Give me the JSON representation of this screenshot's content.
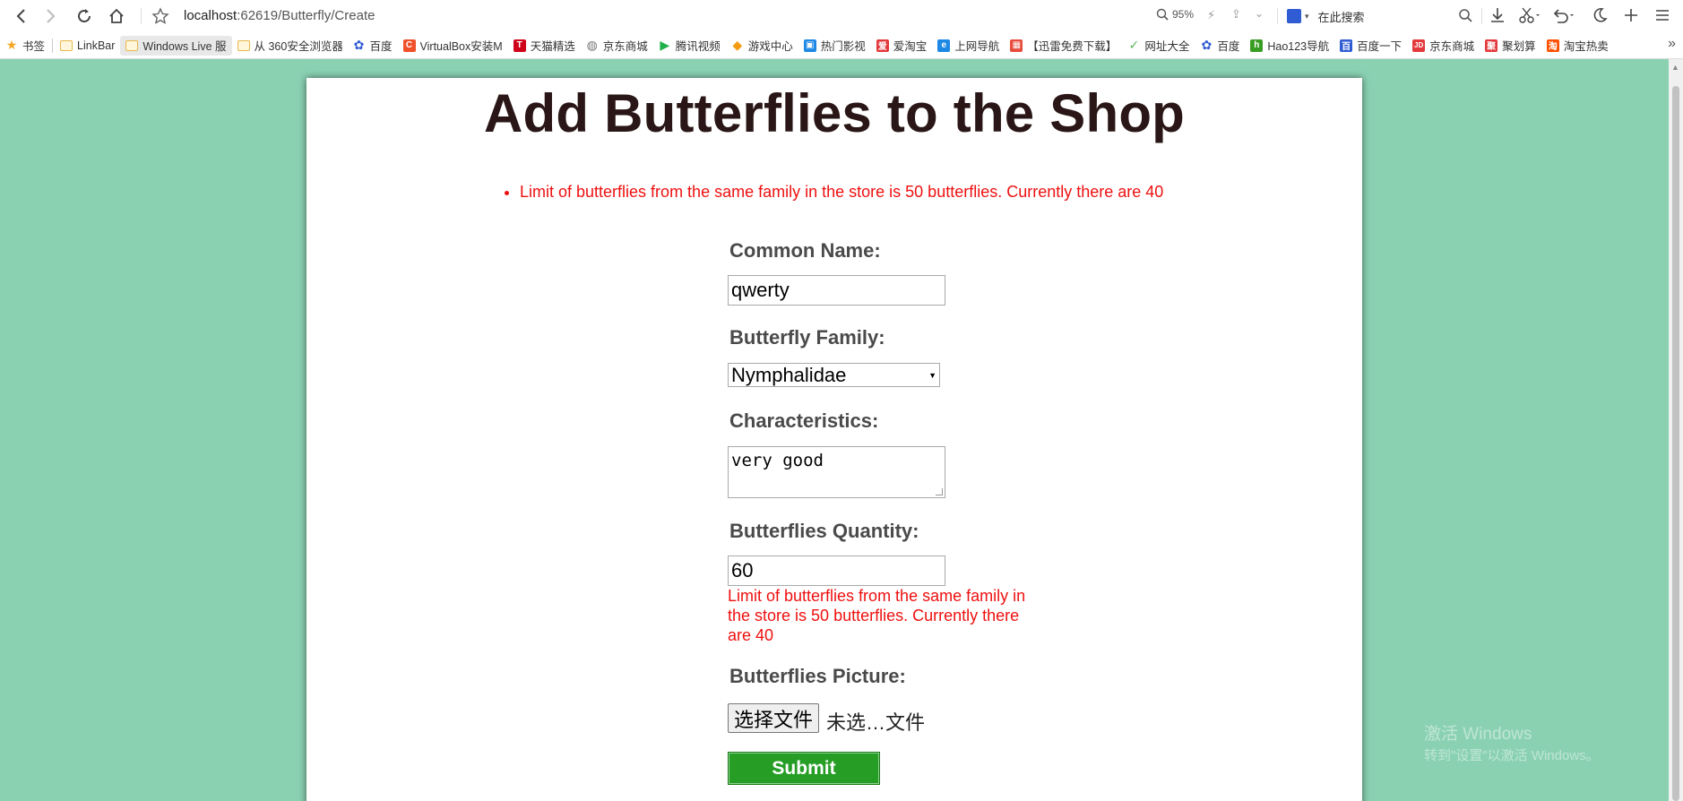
{
  "browser": {
    "url_host": "localhost",
    "url_path": ":62619/Butterfly/Create",
    "zoom": "95%",
    "search_placeholder": "在此搜索"
  },
  "bookmarks": [
    {
      "label": "书签",
      "icon": "star-icon",
      "color": "#f5a623"
    },
    {
      "label": "LinkBar",
      "icon": "folder-icon",
      "color": "#e8b84a"
    },
    {
      "label": "Windows Live 服",
      "icon": "folder-icon",
      "color": "#e8b84a"
    },
    {
      "label": "从 360安全浏览器",
      "icon": "folder-icon",
      "color": "#e8b84a"
    },
    {
      "label": "百度",
      "icon": "paw-icon",
      "color": "#2f5bd3"
    },
    {
      "label": "VirtualBox安装M",
      "icon": "c-icon",
      "color": "#f0502a"
    },
    {
      "label": "天猫精选",
      "icon": "t-icon",
      "color": "#d0021b"
    },
    {
      "label": "京东商城",
      "icon": "globe-icon",
      "color": "#777777"
    },
    {
      "label": "腾讯视频",
      "icon": "play-icon",
      "color": "#20b04b"
    },
    {
      "label": "游戏中心",
      "icon": "gamepad-icon",
      "color": "#f39c12"
    },
    {
      "label": "热门影视",
      "icon": "film-icon",
      "color": "#1e88e5"
    },
    {
      "label": "爱淘宝",
      "icon": "ai-icon",
      "color": "#e4393c"
    },
    {
      "label": "上网导航",
      "icon": "e-icon",
      "color": "#1e88e5"
    },
    {
      "label": "【迅雷免费下载】",
      "icon": "windows-icon",
      "color": "#e74c3c"
    },
    {
      "label": "网址大全",
      "icon": "leaf-icon",
      "color": "#5cb85c"
    },
    {
      "label": "百度",
      "icon": "paw-icon",
      "color": "#2f5bd3"
    },
    {
      "label": "Hao123导航",
      "icon": "hao-icon",
      "color": "#3a9d23"
    },
    {
      "label": "百度一下",
      "icon": "baidu-icon",
      "color": "#2f5bd3"
    },
    {
      "label": "京东商城",
      "icon": "jd-icon",
      "color": "#e4393c"
    },
    {
      "label": "聚划算",
      "icon": "ju-icon",
      "color": "#e4393c"
    },
    {
      "label": "淘宝热卖",
      "icon": "taobao-icon",
      "color": "#ff5000"
    }
  ],
  "page": {
    "title": "Add Butterflies to the Shop",
    "validation_summary": "Limit of butterflies from the same family in the store is 50 butterflies. Currently there are 40"
  },
  "form": {
    "common_name_label": "Common Name:",
    "common_name_value": "qwerty",
    "family_label": "Butterfly Family:",
    "family_selected": "Nymphalidae",
    "characteristics_label": "Characteristics:",
    "characteristics_value": "very good",
    "quantity_label": "Butterflies Quantity:",
    "quantity_value": "60",
    "quantity_error": "Limit of butterflies from the same family in the store is 50 butterflies. Currently there are 40",
    "picture_label": "Butterflies Picture:",
    "file_button": "选择文件",
    "file_status": "未选…文件",
    "submit_label": "Submit"
  },
  "watermark": {
    "line1": "激活 Windows",
    "line2": "转到\"设置\"以激活 Windows。"
  },
  "colors": {
    "background": "#8ad1b2",
    "error": "#ee1010",
    "submit": "#269e26",
    "title": "#2a1616"
  }
}
